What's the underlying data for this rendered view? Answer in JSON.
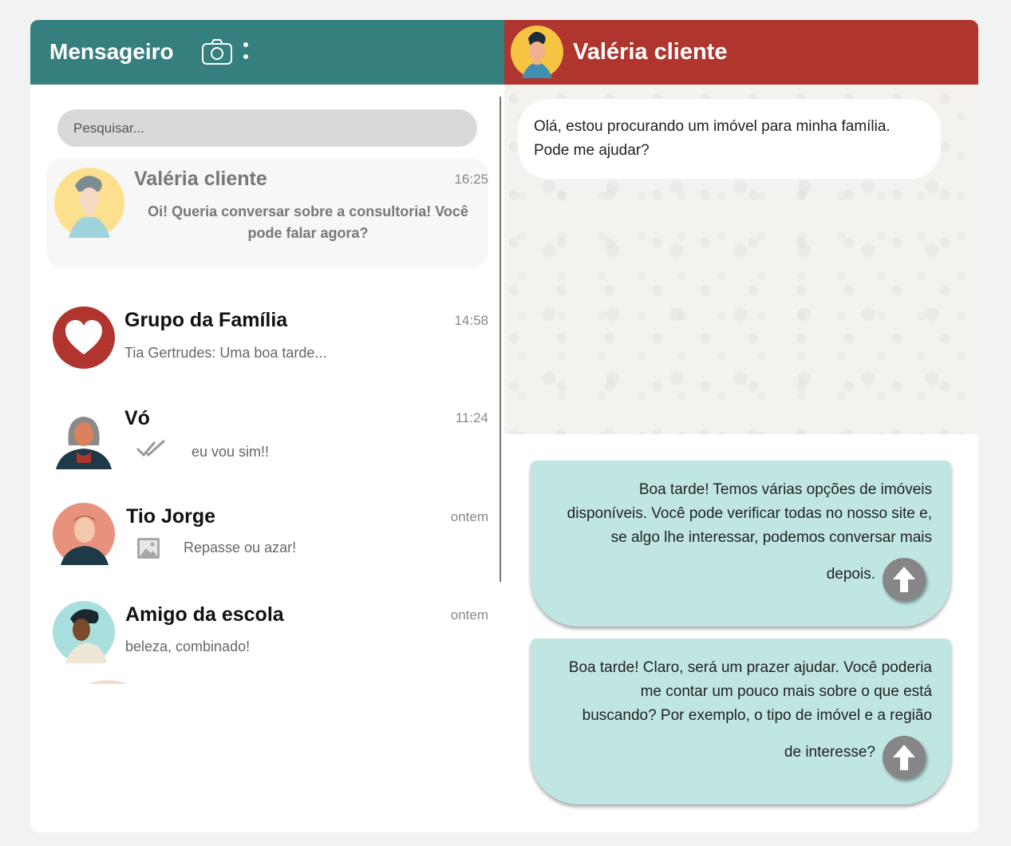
{
  "app": {
    "title": "Mensageiro"
  },
  "search": {
    "placeholder": "Pesquisar..."
  },
  "active_chat": {
    "name": "Valéria cliente"
  },
  "chats": [
    {
      "name": "Valéria cliente",
      "time": "16:25",
      "preview": "Oi! Queria conversar sobre a consultoria! Você pode falar agora?"
    },
    {
      "name": "Grupo da Família",
      "time": "14:58",
      "preview": "Tia Gertrudes: Uma boa tarde..."
    },
    {
      "name": "Vó",
      "time": "11:24",
      "preview": "eu vou sim!!"
    },
    {
      "name": "Tio Jorge",
      "time": "ontem",
      "preview": "Repasse ou azar!"
    },
    {
      "name": "Amigo da escola",
      "time": "ontem",
      "preview": "beleza, combinado!"
    }
  ],
  "messages": {
    "incoming": "Olá, estou procurando um imóvel para minha família. Pode me ajudar?",
    "outgoing": [
      {
        "text": "Boa tarde! Temos várias opções de imóveis disponíveis. Você pode verificar todas no nosso site e, se algo lhe interessar, podemos conversar mais",
        "tail": "depois."
      },
      {
        "text": "Boa tarde! Claro, será um prazer ajudar. Você poderia me contar um pouco mais sobre o que está buscando? Por exemplo, o tipo de imóvel e a região",
        "tail": "de interesse?"
      }
    ]
  },
  "colors": {
    "left_header": "#357f7f",
    "right_header": "#b0352f",
    "outgoing_bubble": "#c0e6e3",
    "send_button": "#868686"
  },
  "icons": [
    "camera-icon",
    "menu-icon",
    "heart-icon",
    "double-check-icon",
    "image-icon",
    "arrow-up-icon"
  ]
}
